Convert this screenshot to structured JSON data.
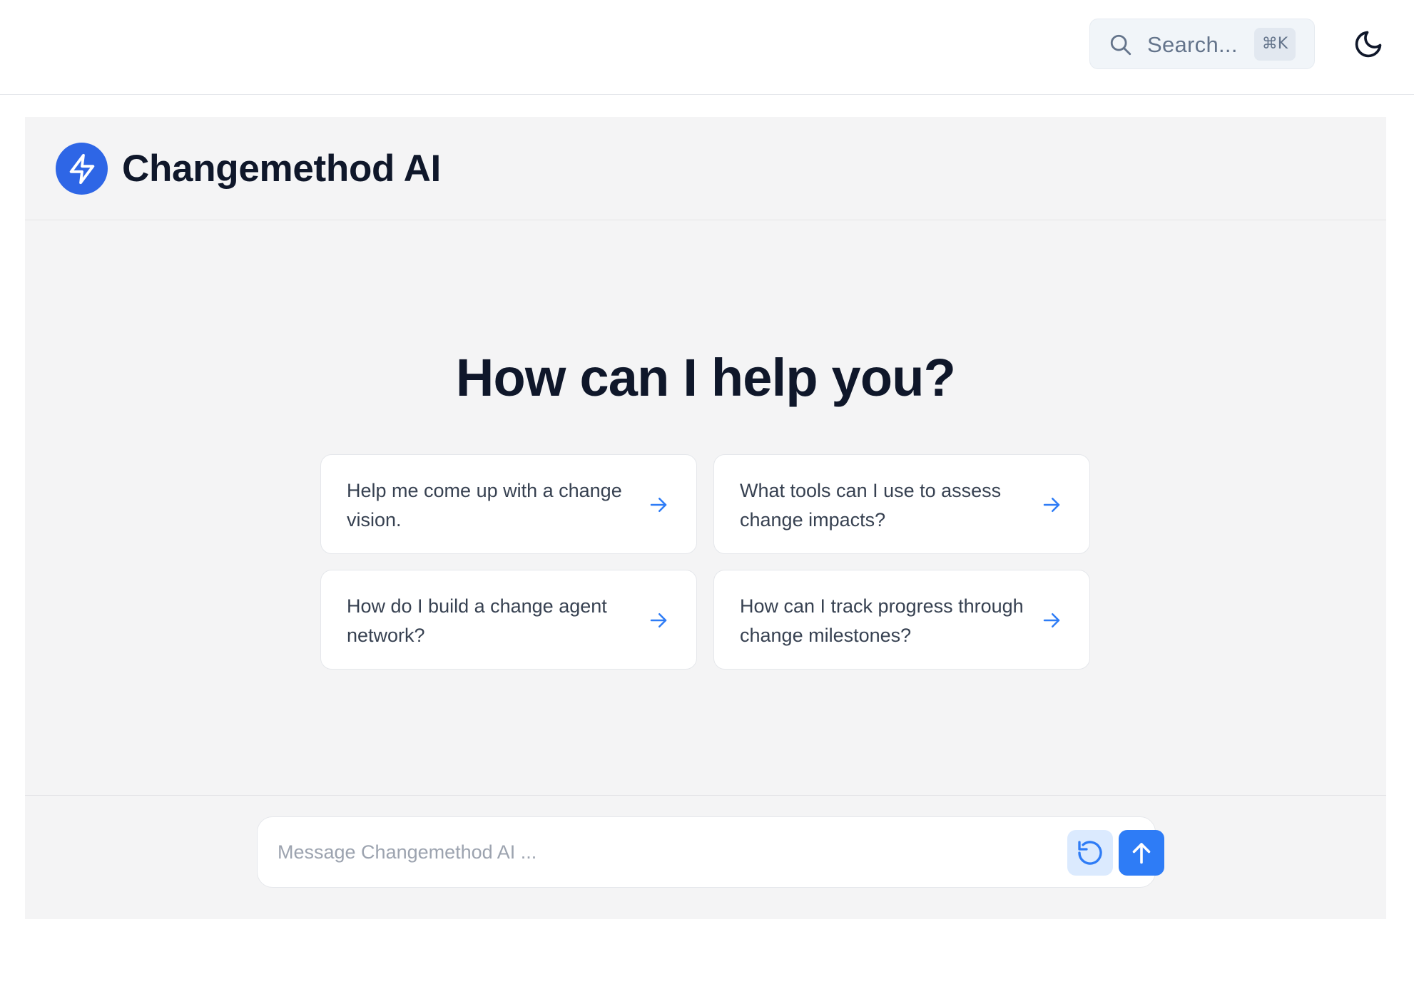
{
  "header": {
    "search": {
      "label": "Search...",
      "shortcut": "⌘K",
      "icon": "search-icon"
    },
    "theme_toggle": {
      "icon": "moon-icon"
    }
  },
  "app": {
    "title": "Changemethod AI",
    "logo_icon": "lightning-bolt-icon",
    "accent_color": "#2e66e6"
  },
  "main": {
    "heading": "How can I help you?",
    "suggestions": [
      {
        "text": "Help me come up with a change vision."
      },
      {
        "text": "What tools can I use to assess change impacts?"
      },
      {
        "text": "How do I build a change agent network?"
      },
      {
        "text": "How can I track progress through change milestones?"
      }
    ]
  },
  "composer": {
    "placeholder": "Message Changemethod AI ...",
    "value": "",
    "reset_icon": "refresh-icon",
    "send_icon": "arrow-up-icon"
  }
}
